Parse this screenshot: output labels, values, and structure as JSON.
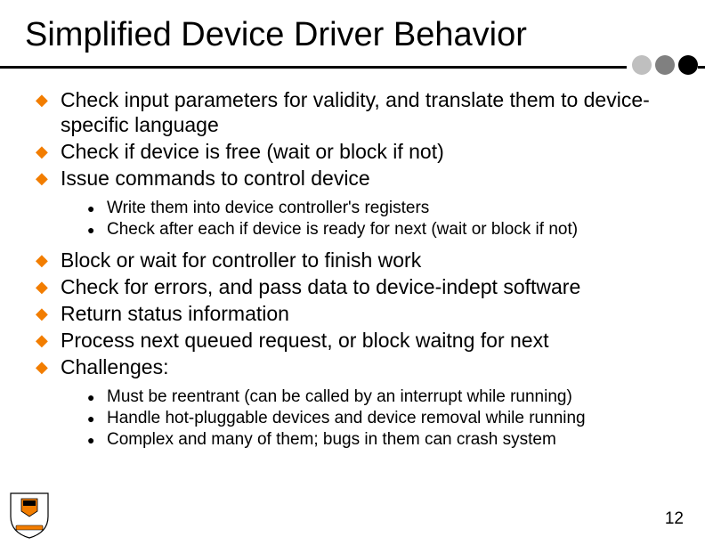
{
  "title": "Simplified Device Driver Behavior",
  "accent": "#f27d00",
  "items": [
    {
      "level": 1,
      "text": "Check input parameters for validity, and translate them to device-specific language"
    },
    {
      "level": 1,
      "text": "Check if device is free (wait or block if not)"
    },
    {
      "level": 1,
      "text": "Issue commands to control device"
    },
    {
      "level": 2,
      "text": "Write them into device controller's registers"
    },
    {
      "level": 2,
      "text": "Check after each if device is ready for next (wait or block if not)"
    },
    {
      "level": 1,
      "text": "Block or wait for controller to finish work"
    },
    {
      "level": 1,
      "text": "Check for errors, and pass data to device-indept software"
    },
    {
      "level": 1,
      "text": "Return status information"
    },
    {
      "level": 1,
      "text": "Process next queued request, or block waitng for next"
    },
    {
      "level": 1,
      "text": "Challenges:"
    },
    {
      "level": 2,
      "text": "Must be reentrant (can be called by an interrupt while running)"
    },
    {
      "level": 2,
      "text": "Handle hot-pluggable devices and device removal while running"
    },
    {
      "level": 2,
      "text": "Complex and many of them; bugs in them can crash system"
    }
  ],
  "page_number": "12"
}
